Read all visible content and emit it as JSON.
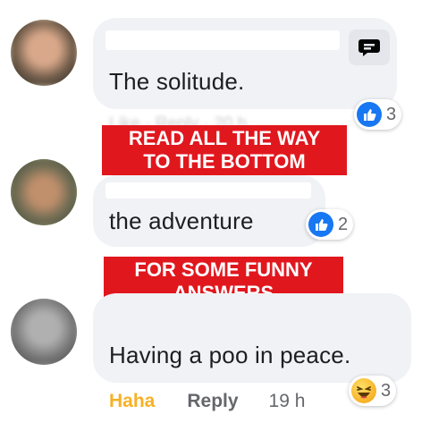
{
  "comments": [
    {
      "text": "The solitude.",
      "reaction": {
        "icon": "like-icon",
        "count": "3"
      }
    },
    {
      "text": "the adventure",
      "reaction": {
        "icon": "like-icon",
        "count": "2"
      }
    },
    {
      "text": "Having a poo in peace.",
      "reaction": {
        "icon": "haha-icon",
        "count": "3"
      },
      "actions": {
        "haha": "Haha",
        "reply": "Reply",
        "time": "19 h"
      }
    }
  ],
  "overlay": {
    "top": [
      "READ ALL THE WAY",
      "TO THE BOTTOM"
    ],
    "bottom": [
      "FOR SOME FUNNY",
      "ANSWERS"
    ]
  },
  "colors": {
    "bubble": "#f0f2f5",
    "banner": "#e1171e",
    "like": "#1877f2",
    "haha": "#f7b125",
    "muted": "#65676b"
  }
}
